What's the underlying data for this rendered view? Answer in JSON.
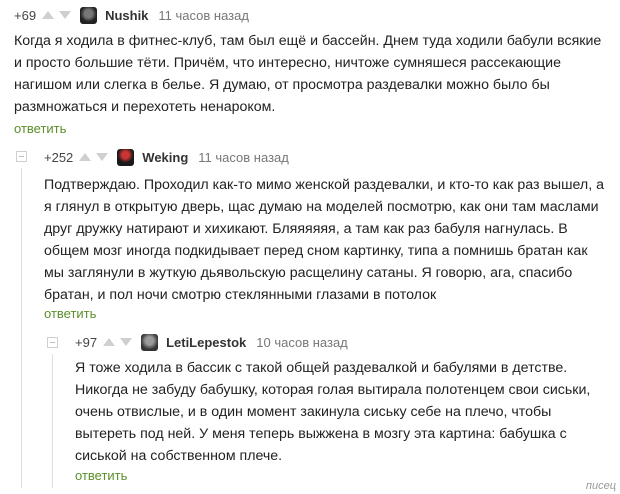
{
  "comments": [
    {
      "rating": "+69",
      "author": "Nushik",
      "time": "11 часов назад",
      "text": "Когда я ходила в фитнес-клуб, там был ещё и бассейн. Днем туда ходили бабули всякие и просто большие тёти. Причём, что интересно, ничтоже сумняшеся рассекающие нагишом или слегка в белье. Я думаю, от просмотра раздевалки можно было бы размножаться и перехотеть ненароком.",
      "reply": "ответить"
    },
    {
      "rating": "+252",
      "author": "Weking",
      "time": "11 часов назад",
      "text": "Подтверждаю. Проходил как-то мимо женской раздевалки, и кто-то как раз вышел, а я глянул в открытую дверь, щас думаю на моделей посмотрю, как они там маслами друг дружку натирают и хихикают. Бляяяяяя, а там как раз бабуля нагнулась. В общем мозг иногда подкидывает перед сном картинку, типа а помнишь братан как мы заглянули в жуткую дьявольскую расщелину сатаны. Я говорю, ага, спасибо братан, и пол ночи смотрю стеклянными глазами в потолок",
      "reply": "ответить"
    },
    {
      "rating": "+97",
      "author": "LetiLepestok",
      "time": "10 часов назад",
      "text": "Я тоже ходила в бассик с такой общей раздевалкой и бабулями в детстве. Никогда не забуду бабушку, которая голая вытирала полотенцем свои сиськи, очень отвислые, и в один момент закинула сиську себе на плечо, чтобы вытереть под ней. У меня теперь выжжена в мозгу эта картина: бабушка с сиськой на собственном плече.",
      "reply": "ответить"
    }
  ],
  "watermark": "писец",
  "icons": [
    "upvote-arrow",
    "downvote-arrow",
    "collapse-toggle"
  ],
  "colors": {
    "reply_link": "#5a8f2a",
    "text": "#222222",
    "meta": "#777777"
  }
}
